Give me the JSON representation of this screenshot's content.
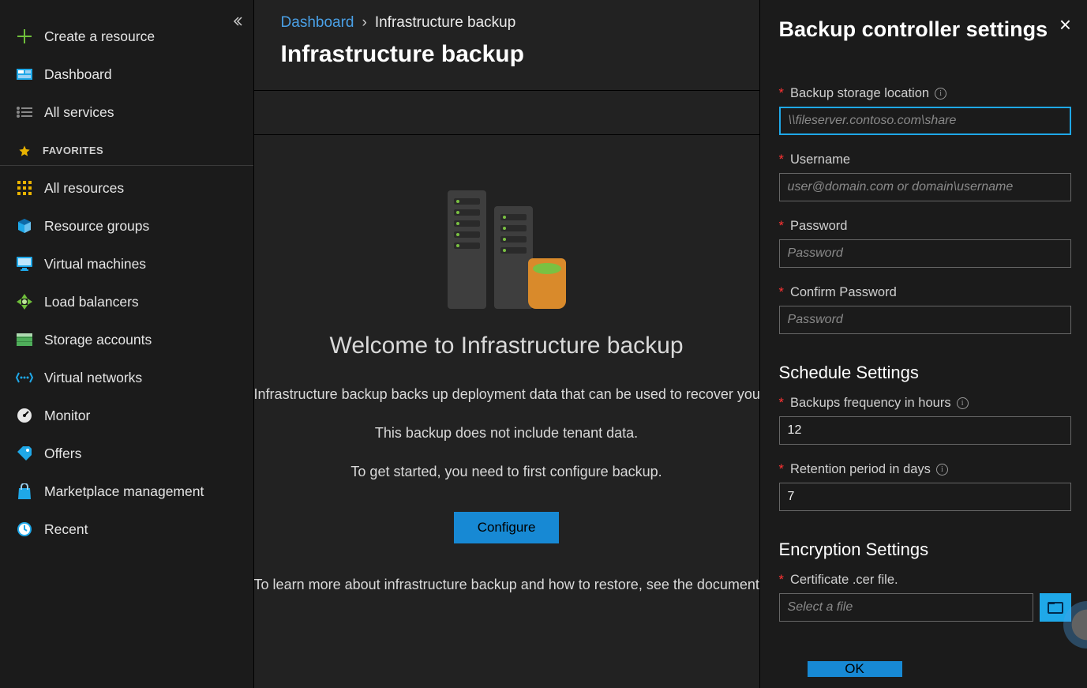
{
  "sidebar": {
    "create": "Create a resource",
    "dashboard": "Dashboard",
    "all_services": "All services",
    "favorites_header": "FAVORITES",
    "all_resources": "All resources",
    "resource_groups": "Resource groups",
    "virtual_machines": "Virtual machines",
    "load_balancers": "Load balancers",
    "storage_accounts": "Storage accounts",
    "virtual_networks": "Virtual networks",
    "monitor": "Monitor",
    "offers": "Offers",
    "marketplace": "Marketplace management",
    "recent": "Recent"
  },
  "breadcrumb": {
    "root": "Dashboard",
    "current": "Infrastructure backup"
  },
  "main": {
    "title": "Infrastructure backup",
    "welcome_heading": "Welcome to Infrastructure backup",
    "line1": "Infrastructure backup backs up deployment data that can be used to recover your deployment.",
    "line2": "This backup does not include tenant data.",
    "line3": "To get started, you need to first configure backup.",
    "configure_label": "Configure",
    "learn_more": "To learn more about infrastructure backup and how to restore, see the documentation."
  },
  "panel": {
    "title": "Backup controller settings",
    "storage_label": "Backup storage location",
    "storage_placeholder": "\\\\fileserver.contoso.com\\share",
    "username_label": "Username",
    "username_placeholder": "user@domain.com or domain\\username",
    "password_label": "Password",
    "password_placeholder": "Password",
    "confirm_label": "Confirm Password",
    "confirm_placeholder": "Password",
    "schedule_heading": "Schedule Settings",
    "freq_label": "Backups frequency in hours",
    "freq_value": "12",
    "retention_label": "Retention period in days",
    "retention_value": "7",
    "encryption_heading": "Encryption Settings",
    "cert_label": "Certificate .cer file.",
    "cert_placeholder": "Select a file",
    "ok_label": "OK"
  }
}
